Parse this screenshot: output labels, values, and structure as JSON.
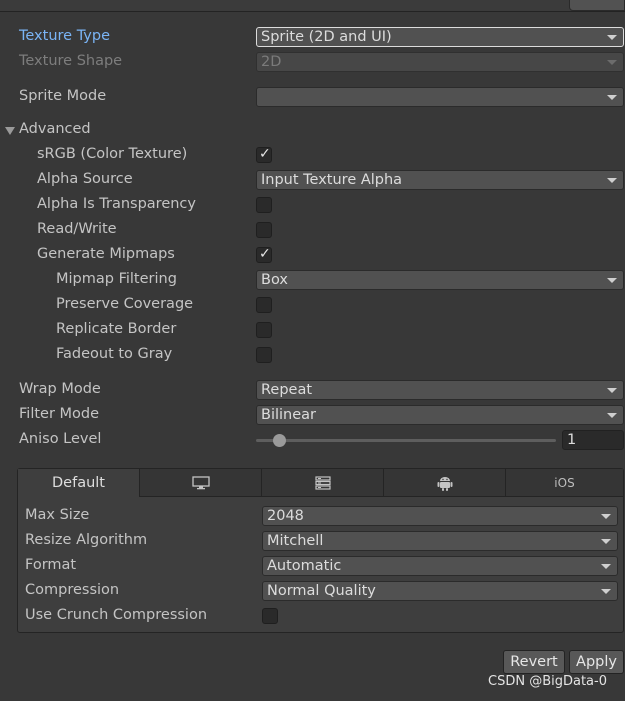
{
  "texture_type": {
    "label": "Texture Type",
    "value": "Sprite (2D and UI)"
  },
  "texture_shape": {
    "label": "Texture Shape",
    "value": "2D"
  },
  "sprite_mode": {
    "label": "Sprite Mode",
    "value": ""
  },
  "advanced": {
    "label": "Advanced",
    "srgb": {
      "label": "sRGB (Color Texture)",
      "checked": true
    },
    "alpha_source": {
      "label": "Alpha Source",
      "value": "Input Texture Alpha"
    },
    "alpha_is_transparency": {
      "label": "Alpha Is Transparency",
      "checked": false
    },
    "read_write": {
      "label": "Read/Write",
      "checked": false
    },
    "generate_mipmaps": {
      "label": "Generate Mipmaps",
      "checked": true
    },
    "mipmap_filtering": {
      "label": "Mipmap Filtering",
      "value": "Box"
    },
    "preserve_coverage": {
      "label": "Preserve Coverage",
      "checked": false
    },
    "replicate_border": {
      "label": "Replicate Border",
      "checked": false
    },
    "fadeout_to_gray": {
      "label": "Fadeout to Gray",
      "checked": false
    }
  },
  "wrap_mode": {
    "label": "Wrap Mode",
    "value": "Repeat"
  },
  "filter_mode": {
    "label": "Filter Mode",
    "value": "Bilinear"
  },
  "aniso_level": {
    "label": "Aniso Level",
    "value": "1"
  },
  "platform_tabs": {
    "default": "Default",
    "standalone_icon": "monitor-icon",
    "server_icon": "server-icon",
    "android_icon": "android-icon",
    "ios": "iOS"
  },
  "platform_settings": {
    "max_size": {
      "label": "Max Size",
      "value": "2048"
    },
    "resize_algorithm": {
      "label": "Resize Algorithm",
      "value": "Mitchell"
    },
    "format": {
      "label": "Format",
      "value": "Automatic"
    },
    "compression": {
      "label": "Compression",
      "value": "Normal Quality"
    },
    "use_crunch": {
      "label": "Use Crunch Compression",
      "checked": false
    }
  },
  "buttons": {
    "revert": "Revert",
    "apply": "Apply"
  },
  "watermark": "CSDN @BigData-0",
  "colors": {
    "accent_label": "#7ab4f5",
    "background": "#383838"
  }
}
